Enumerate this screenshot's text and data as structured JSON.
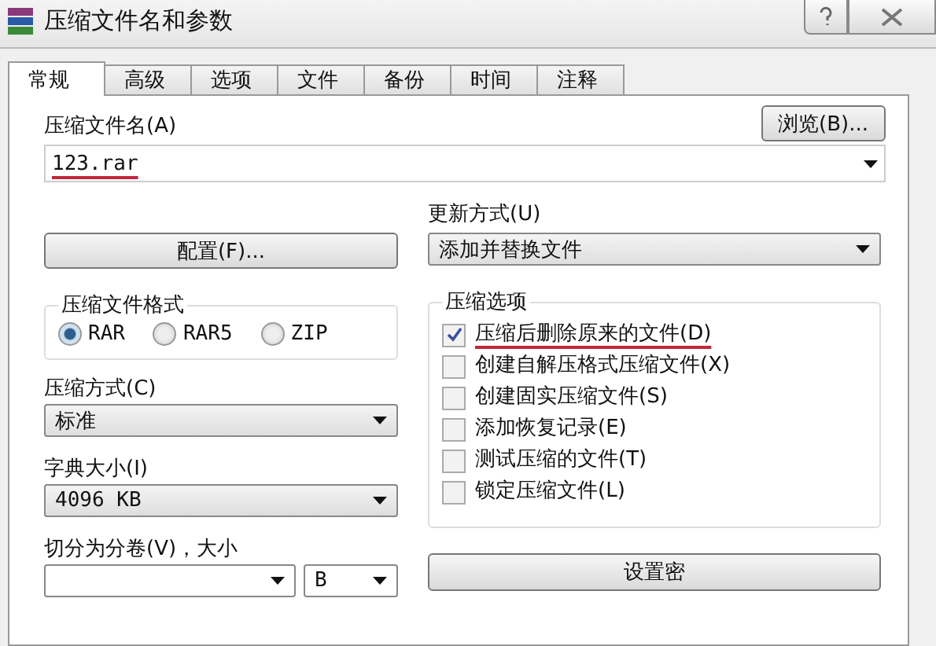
{
  "window": {
    "title": "压缩文件名和参数"
  },
  "tabs": [
    {
      "label": "常规",
      "selected": true
    },
    {
      "label": "高级",
      "selected": false
    },
    {
      "label": "选项",
      "selected": false
    },
    {
      "label": "文件",
      "selected": false
    },
    {
      "label": "备份",
      "selected": false
    },
    {
      "label": "时间",
      "selected": false
    },
    {
      "label": "注释",
      "selected": false
    }
  ],
  "archive_name": {
    "label": "压缩文件名(A)",
    "value": "123.rar",
    "browse_button": "浏览(B)..."
  },
  "profiles_button": "配置(F)...",
  "update_mode": {
    "label": "更新方式(U)",
    "value": "添加并替换文件"
  },
  "archive_format": {
    "title": "压缩文件格式",
    "options": [
      {
        "label": "RAR",
        "selected": true
      },
      {
        "label": "RAR5",
        "selected": false
      },
      {
        "label": "ZIP",
        "selected": false
      }
    ]
  },
  "compression_method": {
    "label": "压缩方式(C)",
    "value": "标准"
  },
  "dictionary_size": {
    "label": "字典大小(I)",
    "value": "4096 KB"
  },
  "split_volumes": {
    "label": "切分为分卷(V)，大小",
    "unit": "B"
  },
  "archiving_options": {
    "title": "压缩选项",
    "items": [
      {
        "label": "压缩后删除原来的文件(D)",
        "checked": true
      },
      {
        "label": "创建自解压格式压缩文件(X)",
        "checked": false
      },
      {
        "label": "创建固实压缩文件(S)",
        "checked": false
      },
      {
        "label": "添加恢复记录(E)",
        "checked": false
      },
      {
        "label": "测试压缩的文件(T)",
        "checked": false
      },
      {
        "label": "锁定压缩文件(L)",
        "checked": false
      }
    ]
  },
  "password_button": "设置密"
}
